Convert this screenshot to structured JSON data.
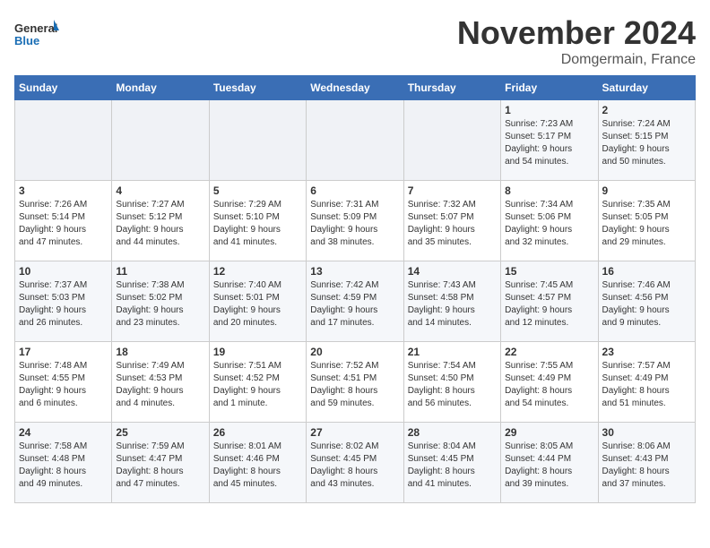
{
  "header": {
    "logo_line1": "General",
    "logo_line2": "Blue",
    "title": "November 2024",
    "subtitle": "Domgermain, France"
  },
  "weekdays": [
    "Sunday",
    "Monday",
    "Tuesday",
    "Wednesday",
    "Thursday",
    "Friday",
    "Saturday"
  ],
  "weeks": [
    [
      {
        "day": "",
        "info": ""
      },
      {
        "day": "",
        "info": ""
      },
      {
        "day": "",
        "info": ""
      },
      {
        "day": "",
        "info": ""
      },
      {
        "day": "",
        "info": ""
      },
      {
        "day": "1",
        "info": "Sunrise: 7:23 AM\nSunset: 5:17 PM\nDaylight: 9 hours\nand 54 minutes."
      },
      {
        "day": "2",
        "info": "Sunrise: 7:24 AM\nSunset: 5:15 PM\nDaylight: 9 hours\nand 50 minutes."
      }
    ],
    [
      {
        "day": "3",
        "info": "Sunrise: 7:26 AM\nSunset: 5:14 PM\nDaylight: 9 hours\nand 47 minutes."
      },
      {
        "day": "4",
        "info": "Sunrise: 7:27 AM\nSunset: 5:12 PM\nDaylight: 9 hours\nand 44 minutes."
      },
      {
        "day": "5",
        "info": "Sunrise: 7:29 AM\nSunset: 5:10 PM\nDaylight: 9 hours\nand 41 minutes."
      },
      {
        "day": "6",
        "info": "Sunrise: 7:31 AM\nSunset: 5:09 PM\nDaylight: 9 hours\nand 38 minutes."
      },
      {
        "day": "7",
        "info": "Sunrise: 7:32 AM\nSunset: 5:07 PM\nDaylight: 9 hours\nand 35 minutes."
      },
      {
        "day": "8",
        "info": "Sunrise: 7:34 AM\nSunset: 5:06 PM\nDaylight: 9 hours\nand 32 minutes."
      },
      {
        "day": "9",
        "info": "Sunrise: 7:35 AM\nSunset: 5:05 PM\nDaylight: 9 hours\nand 29 minutes."
      }
    ],
    [
      {
        "day": "10",
        "info": "Sunrise: 7:37 AM\nSunset: 5:03 PM\nDaylight: 9 hours\nand 26 minutes."
      },
      {
        "day": "11",
        "info": "Sunrise: 7:38 AM\nSunset: 5:02 PM\nDaylight: 9 hours\nand 23 minutes."
      },
      {
        "day": "12",
        "info": "Sunrise: 7:40 AM\nSunset: 5:01 PM\nDaylight: 9 hours\nand 20 minutes."
      },
      {
        "day": "13",
        "info": "Sunrise: 7:42 AM\nSunset: 4:59 PM\nDaylight: 9 hours\nand 17 minutes."
      },
      {
        "day": "14",
        "info": "Sunrise: 7:43 AM\nSunset: 4:58 PM\nDaylight: 9 hours\nand 14 minutes."
      },
      {
        "day": "15",
        "info": "Sunrise: 7:45 AM\nSunset: 4:57 PM\nDaylight: 9 hours\nand 12 minutes."
      },
      {
        "day": "16",
        "info": "Sunrise: 7:46 AM\nSunset: 4:56 PM\nDaylight: 9 hours\nand 9 minutes."
      }
    ],
    [
      {
        "day": "17",
        "info": "Sunrise: 7:48 AM\nSunset: 4:55 PM\nDaylight: 9 hours\nand 6 minutes."
      },
      {
        "day": "18",
        "info": "Sunrise: 7:49 AM\nSunset: 4:53 PM\nDaylight: 9 hours\nand 4 minutes."
      },
      {
        "day": "19",
        "info": "Sunrise: 7:51 AM\nSunset: 4:52 PM\nDaylight: 9 hours\nand 1 minute."
      },
      {
        "day": "20",
        "info": "Sunrise: 7:52 AM\nSunset: 4:51 PM\nDaylight: 8 hours\nand 59 minutes."
      },
      {
        "day": "21",
        "info": "Sunrise: 7:54 AM\nSunset: 4:50 PM\nDaylight: 8 hours\nand 56 minutes."
      },
      {
        "day": "22",
        "info": "Sunrise: 7:55 AM\nSunset: 4:49 PM\nDaylight: 8 hours\nand 54 minutes."
      },
      {
        "day": "23",
        "info": "Sunrise: 7:57 AM\nSunset: 4:49 PM\nDaylight: 8 hours\nand 51 minutes."
      }
    ],
    [
      {
        "day": "24",
        "info": "Sunrise: 7:58 AM\nSunset: 4:48 PM\nDaylight: 8 hours\nand 49 minutes."
      },
      {
        "day": "25",
        "info": "Sunrise: 7:59 AM\nSunset: 4:47 PM\nDaylight: 8 hours\nand 47 minutes."
      },
      {
        "day": "26",
        "info": "Sunrise: 8:01 AM\nSunset: 4:46 PM\nDaylight: 8 hours\nand 45 minutes."
      },
      {
        "day": "27",
        "info": "Sunrise: 8:02 AM\nSunset: 4:45 PM\nDaylight: 8 hours\nand 43 minutes."
      },
      {
        "day": "28",
        "info": "Sunrise: 8:04 AM\nSunset: 4:45 PM\nDaylight: 8 hours\nand 41 minutes."
      },
      {
        "day": "29",
        "info": "Sunrise: 8:05 AM\nSunset: 4:44 PM\nDaylight: 8 hours\nand 39 minutes."
      },
      {
        "day": "30",
        "info": "Sunrise: 8:06 AM\nSunset: 4:43 PM\nDaylight: 8 hours\nand 37 minutes."
      }
    ]
  ]
}
